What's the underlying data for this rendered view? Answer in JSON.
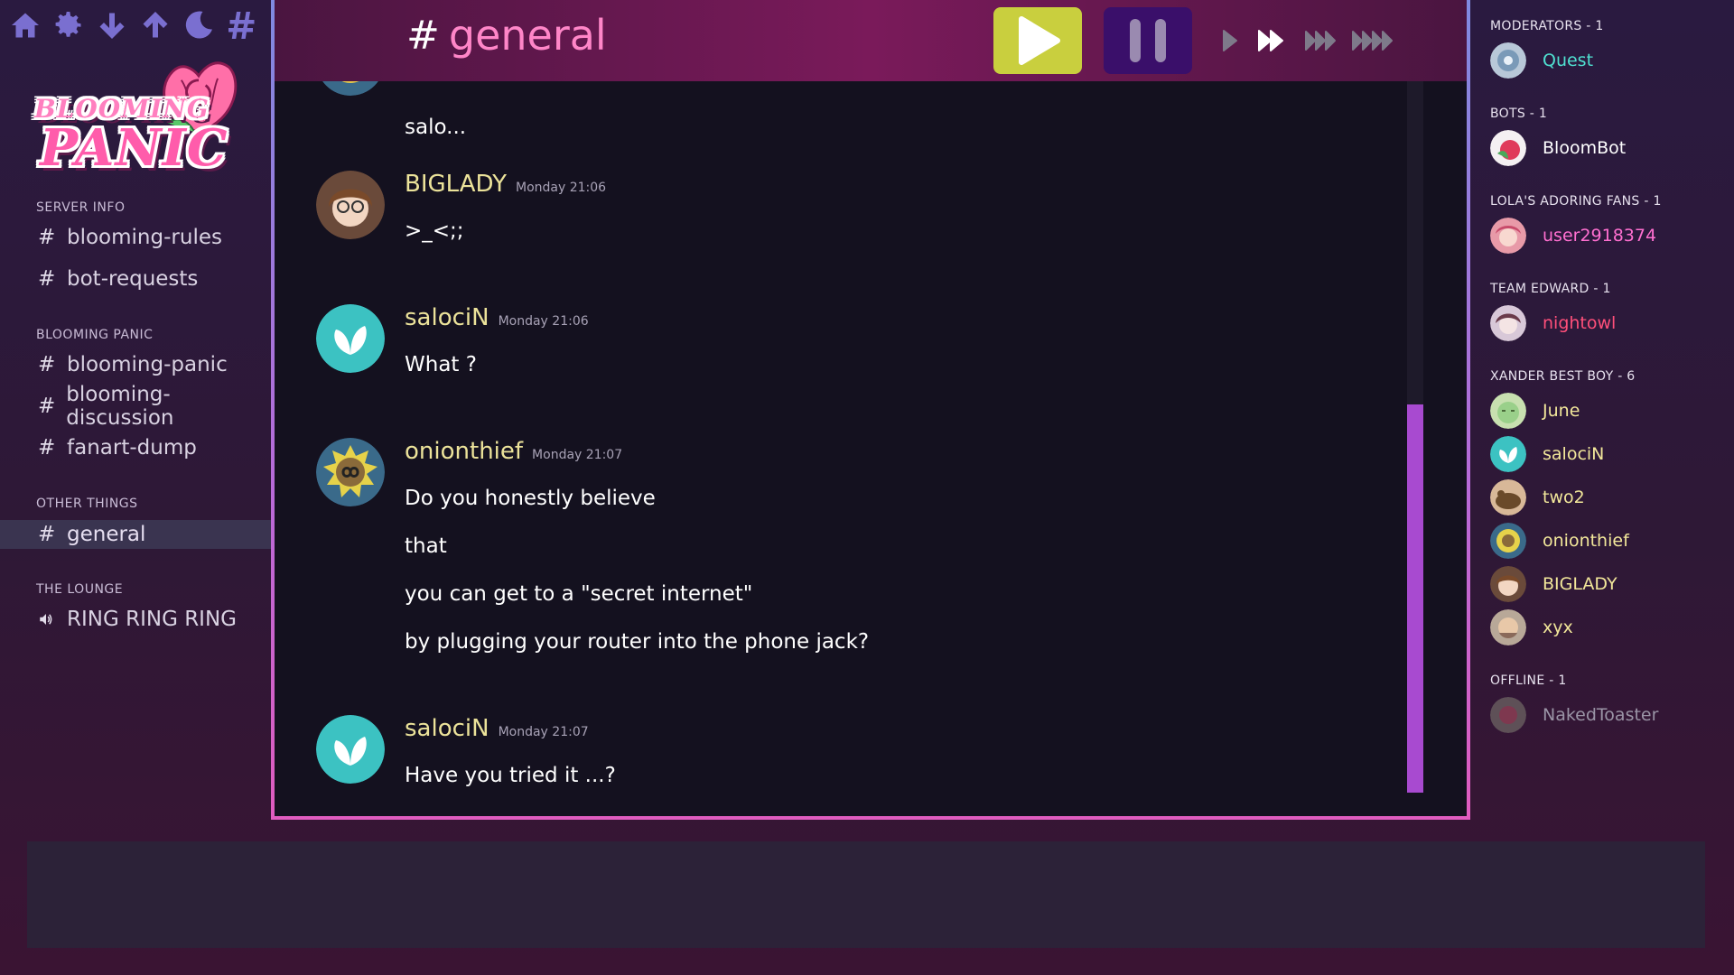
{
  "toolbar": {
    "icons": [
      "home-icon",
      "gear-icon",
      "arrow-down-icon",
      "arrow-up-icon",
      "moon-icon",
      "hash-icon"
    ]
  },
  "logo": {
    "line1": "BLOOMING",
    "line2": "PANIC"
  },
  "sidebar": {
    "categories": [
      {
        "label": "SERVER INFO",
        "channels": [
          "blooming-rules",
          "bot-requests"
        ]
      },
      {
        "label": "BLOOMING PANIC",
        "channels": [
          "blooming-panic",
          "blooming-discussion",
          "fanart-dump"
        ]
      },
      {
        "label": "OTHER THINGS",
        "channels": [
          "general"
        ]
      },
      {
        "label": "THE LOUNGE",
        "channels": [
          "RING RING RING"
        ]
      }
    ],
    "hash": "#"
  },
  "header": {
    "hash": "#",
    "channel": "general"
  },
  "messages": [
    {
      "author": "",
      "time": "",
      "lines": [
        "salo..."
      ]
    },
    {
      "author": "BIGLADY",
      "time": "Monday 21:06",
      "lines": [
        ">_<;;"
      ]
    },
    {
      "author": "salociN",
      "time": "Monday 21:06",
      "lines": [
        "What ?"
      ]
    },
    {
      "author": "onionthief",
      "time": "Monday 21:07",
      "lines": [
        "Do you honestly believe",
        "that",
        "you can get to a \"secret internet\"",
        "by plugging your router into the phone jack?"
      ]
    },
    {
      "author": "salociN",
      "time": "Monday 21:07",
      "lines": [
        "Have you tried it ...?"
      ]
    }
  ],
  "scroll": {
    "position": 0.98,
    "visible_fraction": 0.55
  },
  "members": {
    "groups": [
      {
        "label": "MODERATORS - 1",
        "members": [
          {
            "name": "Quest",
            "color": "#4fe0d0"
          }
        ]
      },
      {
        "label": "BOTS - 1",
        "members": [
          {
            "name": "BloomBot",
            "color": "#ffffff"
          }
        ]
      },
      {
        "label": "LOLA'S ADORING FANS - 1",
        "members": [
          {
            "name": "user2918374",
            "color": "#ff6fd0"
          }
        ]
      },
      {
        "label": "TEAM EDWARD - 1",
        "members": [
          {
            "name": "nightowl",
            "color": "#ff4f7a"
          }
        ]
      },
      {
        "label": "XANDER BEST BOY - 6",
        "members": [
          {
            "name": "June",
            "color": "#f2e79a"
          },
          {
            "name": "salociN",
            "color": "#f2e79a"
          },
          {
            "name": "two2",
            "color": "#f2e79a"
          },
          {
            "name": "onionthief",
            "color": "#f2e79a"
          },
          {
            "name": "BIGLADY",
            "color": "#f2e79a"
          },
          {
            "name": "xyx",
            "color": "#f2e79a"
          }
        ]
      },
      {
        "label": "OFFLINE - 1",
        "members": [
          {
            "name": "NakedToaster",
            "color": "#9a94a6"
          }
        ]
      }
    ]
  },
  "colors": {
    "accent_pink": "#ff86c8",
    "play_button": "#c9cf3e",
    "pause_button": "#3a0f6a",
    "scroll_thumb": "#a84ad0"
  }
}
